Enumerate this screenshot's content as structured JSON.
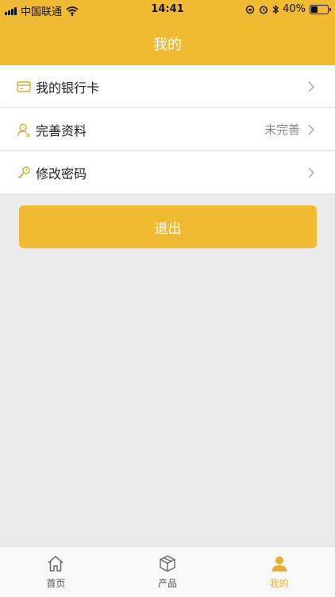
{
  "status_bar": {
    "carrier": "中国联通",
    "time": "14:41",
    "battery": "40%",
    "battery_level": 0.4
  },
  "header": {
    "title": "我的"
  },
  "menu": {
    "items": [
      {
        "label": "我的银行卡",
        "value": "",
        "icon": "bank-card-icon"
      },
      {
        "label": "完善资料",
        "value": "未完善",
        "icon": "user-profile-icon"
      },
      {
        "label": "修改密码",
        "value": "",
        "icon": "key-icon"
      }
    ]
  },
  "logout": {
    "label": "退出"
  },
  "tabbar": {
    "tabs": [
      {
        "label": "首页",
        "icon": "home-icon"
      },
      {
        "label": "产品",
        "icon": "box-icon"
      },
      {
        "label": "我的",
        "icon": "person-icon",
        "active": true
      }
    ]
  },
  "colors": {
    "accent": "#f0bb33",
    "active_tab": "#e8b12c",
    "background": "#ebebeb"
  }
}
